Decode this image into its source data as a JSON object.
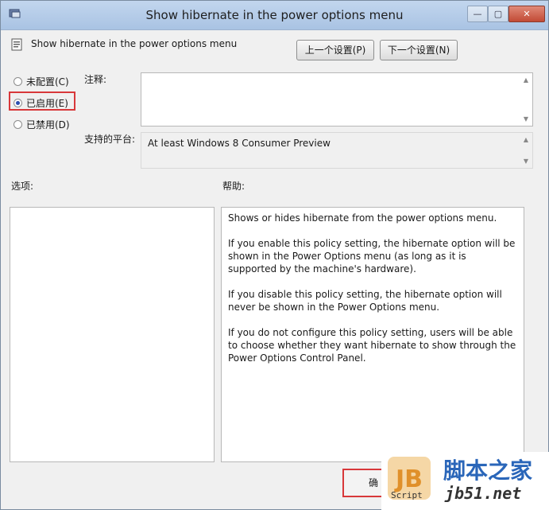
{
  "window": {
    "title": "Show hibernate in the power options menu",
    "controls": {
      "minimize": "—",
      "maximize": "▢",
      "close": "✕"
    }
  },
  "header": {
    "setting_name": "Show hibernate in the power options menu",
    "prev_setting_label": "上一个设置(P)",
    "next_setting_label": "下一个设置(N)"
  },
  "state_options": [
    {
      "label": "未配置(C)",
      "checked": false
    },
    {
      "label": "已启用(E)",
      "checked": true
    },
    {
      "label": "已禁用(D)",
      "checked": false
    }
  ],
  "comment": {
    "label": "注释:",
    "value": ""
  },
  "supported_on": {
    "label": "支持的平台:",
    "value": "At least Windows 8 Consumer Preview"
  },
  "options": {
    "label": "选项:"
  },
  "help": {
    "label": "帮助:",
    "paragraphs": [
      "Shows or hides hibernate from the power options menu.",
      "If you enable this policy setting, the hibernate option will be shown in the Power Options menu (as long as it is supported by the machine's hardware).",
      "If you disable this policy setting, the hibernate option will never be shown in the Power Options menu.",
      "If you do not configure this policy setting, users will be able to choose whether they want hibernate to show through the Power Options Control Panel."
    ]
  },
  "footer": {
    "ok_label_partial": "确"
  },
  "watermark": {
    "logo_letters": "JB",
    "script_text": "Script",
    "site_cn": "脚本之家",
    "site_url": "jb51.net"
  },
  "colors": {
    "titlebar": "#b6cde9",
    "highlight": "#d8383a",
    "accent": "#2a66b9"
  }
}
